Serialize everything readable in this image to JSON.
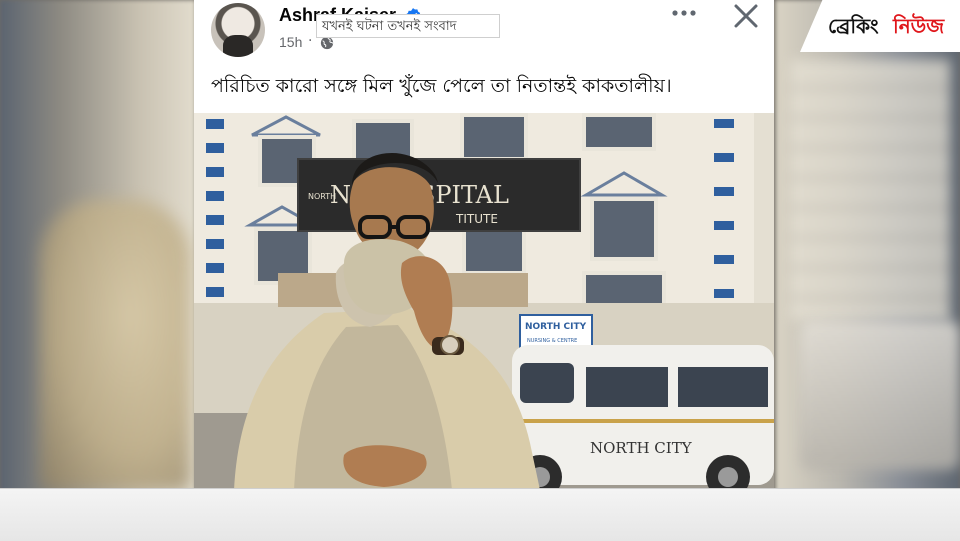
{
  "post": {
    "author": "Ashraf Kaiser",
    "time": "15h",
    "separator": "·",
    "privacy_icon": "globe-icon",
    "verified_icon": "verified-badge-icon",
    "caption": "পরিচিত কারো সঙ্গে মিল খুঁজে পেলে তা নিতান্তই কাকতালীয়।",
    "image": {
      "hospital_sign_line1": "NO      HOSPITAL",
      "hospital_sign_small": "NORTH",
      "hospital_sign_line2": "TITUTE",
      "center_sign_line1": "NORTH CITY",
      "center_sign_line2": "NURSING & CENTRE",
      "van_text": "NORTH CITY"
    }
  },
  "ticker": {
    "tagline": "যখনই ঘটনা তখনই সংবাদ",
    "brand_part1": "ব্রেকিং",
    "brand_part2": "নিউজ"
  },
  "colors": {
    "brand_red": "#e0161b",
    "verified_blue": "#1877f2",
    "text_primary": "#050505",
    "text_secondary": "#65676b"
  }
}
